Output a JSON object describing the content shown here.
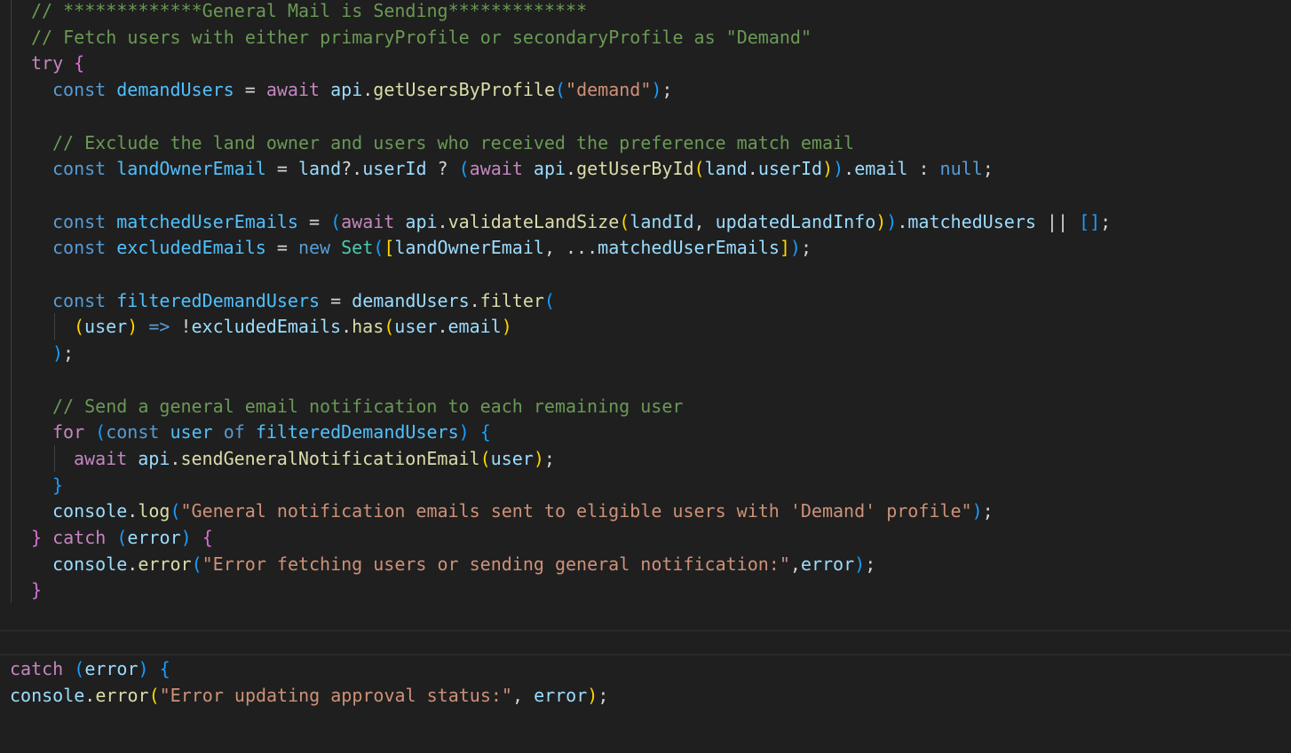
{
  "colors": {
    "background": "#1f1f1f",
    "comment": "#6A9955",
    "keyword": "#569CD6",
    "string": "#CE9178",
    "function": "#DCDCAA",
    "control": "#C586C0"
  },
  "code": [
    {
      "indent": 0,
      "tokens": [
        [
          "// *************General Mail is Sending*************",
          "c"
        ]
      ]
    },
    {
      "indent": 0,
      "tokens": [
        [
          "// Fetch users with either primaryProfile or secondaryProfile as \"Demand\"",
          "c"
        ]
      ]
    },
    {
      "indent": 0,
      "tokens": [
        [
          "try",
          "ctl"
        ],
        [
          " ",
          "o"
        ],
        [
          "{",
          "b2"
        ]
      ]
    },
    {
      "indent": 1,
      "tokens": [
        [
          "const",
          "k"
        ],
        [
          " ",
          "o"
        ],
        [
          "demandUsers",
          "v"
        ],
        [
          " = ",
          "o"
        ],
        [
          "await",
          "ctl"
        ],
        [
          " ",
          "o"
        ],
        [
          "api",
          "p"
        ],
        [
          ".",
          "o"
        ],
        [
          "getUsersByProfile",
          "f"
        ],
        [
          "(",
          "b3"
        ],
        [
          "\"demand\"",
          "s"
        ],
        [
          ")",
          "b3"
        ],
        [
          ";",
          "o"
        ]
      ]
    },
    {
      "indent": 1,
      "tokens": []
    },
    {
      "indent": 1,
      "tokens": [
        [
          "// Exclude the land owner and users who received the preference match email",
          "c"
        ]
      ]
    },
    {
      "indent": 1,
      "tokens": [
        [
          "const",
          "k"
        ],
        [
          " ",
          "o"
        ],
        [
          "landOwnerEmail",
          "v"
        ],
        [
          " = ",
          "o"
        ],
        [
          "land",
          "p"
        ],
        [
          "?.",
          "o"
        ],
        [
          "userId",
          "p"
        ],
        [
          " ? ",
          "o"
        ],
        [
          "(",
          "b3"
        ],
        [
          "await",
          "ctl"
        ],
        [
          " ",
          "o"
        ],
        [
          "api",
          "p"
        ],
        [
          ".",
          "o"
        ],
        [
          "getUserById",
          "f"
        ],
        [
          "(",
          "b1"
        ],
        [
          "land",
          "p"
        ],
        [
          ".",
          "o"
        ],
        [
          "userId",
          "p"
        ],
        [
          ")",
          "b1"
        ],
        [
          ")",
          "b3"
        ],
        [
          ".",
          "o"
        ],
        [
          "email",
          "p"
        ],
        [
          " : ",
          "o"
        ],
        [
          "null",
          "k"
        ],
        [
          ";",
          "o"
        ]
      ]
    },
    {
      "indent": 1,
      "tokens": []
    },
    {
      "indent": 1,
      "tokens": [
        [
          "const",
          "k"
        ],
        [
          " ",
          "o"
        ],
        [
          "matchedUserEmails",
          "v"
        ],
        [
          " = ",
          "o"
        ],
        [
          "(",
          "b3"
        ],
        [
          "await",
          "ctl"
        ],
        [
          " ",
          "o"
        ],
        [
          "api",
          "p"
        ],
        [
          ".",
          "o"
        ],
        [
          "validateLandSize",
          "f"
        ],
        [
          "(",
          "b1"
        ],
        [
          "landId",
          "p"
        ],
        [
          ", ",
          "o"
        ],
        [
          "updatedLandInfo",
          "p"
        ],
        [
          ")",
          "b1"
        ],
        [
          ")",
          "b3"
        ],
        [
          ".",
          "o"
        ],
        [
          "matchedUsers",
          "p"
        ],
        [
          " || ",
          "o"
        ],
        [
          "[]",
          "b3"
        ],
        [
          ";",
          "o"
        ]
      ]
    },
    {
      "indent": 1,
      "tokens": [
        [
          "const",
          "k"
        ],
        [
          " ",
          "o"
        ],
        [
          "excludedEmails",
          "v"
        ],
        [
          " = ",
          "o"
        ],
        [
          "new",
          "k"
        ],
        [
          " ",
          "o"
        ],
        [
          "Set",
          "t"
        ],
        [
          "(",
          "b3"
        ],
        [
          "[",
          "b1"
        ],
        [
          "landOwnerEmail",
          "p"
        ],
        [
          ", ...",
          "o"
        ],
        [
          "matchedUserEmails",
          "p"
        ],
        [
          "]",
          "b1"
        ],
        [
          ")",
          "b3"
        ],
        [
          ";",
          "o"
        ]
      ]
    },
    {
      "indent": 1,
      "tokens": []
    },
    {
      "indent": 1,
      "tokens": [
        [
          "const",
          "k"
        ],
        [
          " ",
          "o"
        ],
        [
          "filteredDemandUsers",
          "v"
        ],
        [
          " = ",
          "o"
        ],
        [
          "demandUsers",
          "p"
        ],
        [
          ".",
          "o"
        ],
        [
          "filter",
          "f"
        ],
        [
          "(",
          "b3"
        ]
      ]
    },
    {
      "indent": 2,
      "tokens": [
        [
          "(",
          "b1"
        ],
        [
          "user",
          "p"
        ],
        [
          ")",
          "b1"
        ],
        [
          " ",
          "o"
        ],
        [
          "=>",
          "k"
        ],
        [
          " !",
          "o"
        ],
        [
          "excludedEmails",
          "p"
        ],
        [
          ".",
          "o"
        ],
        [
          "has",
          "f"
        ],
        [
          "(",
          "b1"
        ],
        [
          "user",
          "p"
        ],
        [
          ".",
          "o"
        ],
        [
          "email",
          "p"
        ],
        [
          ")",
          "b1"
        ]
      ]
    },
    {
      "indent": 1,
      "tokens": [
        [
          ")",
          "b3"
        ],
        [
          ";",
          "o"
        ]
      ]
    },
    {
      "indent": 1,
      "tokens": []
    },
    {
      "indent": 1,
      "tokens": [
        [
          "// Send a general email notification to each remaining user",
          "c"
        ]
      ]
    },
    {
      "indent": 1,
      "tokens": [
        [
          "for",
          "ctl"
        ],
        [
          " ",
          "o"
        ],
        [
          "(",
          "b3"
        ],
        [
          "const",
          "k"
        ],
        [
          " ",
          "o"
        ],
        [
          "user",
          "v"
        ],
        [
          " ",
          "o"
        ],
        [
          "of",
          "k"
        ],
        [
          " ",
          "o"
        ],
        [
          "filteredDemandUsers",
          "v"
        ],
        [
          ")",
          "b3"
        ],
        [
          " ",
          "o"
        ],
        [
          "{",
          "b3"
        ]
      ]
    },
    {
      "indent": 2,
      "tokens": [
        [
          "await",
          "ctl"
        ],
        [
          " ",
          "o"
        ],
        [
          "api",
          "p"
        ],
        [
          ".",
          "o"
        ],
        [
          "sendGeneralNotificationEmail",
          "f"
        ],
        [
          "(",
          "b1"
        ],
        [
          "user",
          "p"
        ],
        [
          ")",
          "b1"
        ],
        [
          ";",
          "o"
        ]
      ]
    },
    {
      "indent": 1,
      "tokens": [
        [
          "}",
          "b3"
        ]
      ]
    },
    {
      "indent": 1,
      "tokens": [
        [
          "console",
          "p"
        ],
        [
          ".",
          "o"
        ],
        [
          "log",
          "f"
        ],
        [
          "(",
          "b3"
        ],
        [
          "\"General notification emails sent to eligible users with 'Demand' profile\"",
          "s"
        ],
        [
          ")",
          "b3"
        ],
        [
          ";",
          "o"
        ]
      ]
    },
    {
      "indent": 0,
      "tokens": [
        [
          "}",
          "b2"
        ],
        [
          " ",
          "o"
        ],
        [
          "catch",
          "ctl"
        ],
        [
          " ",
          "o"
        ],
        [
          "(",
          "b3"
        ],
        [
          "error",
          "p"
        ],
        [
          ")",
          "b3"
        ],
        [
          " ",
          "o"
        ],
        [
          "{",
          "b2"
        ]
      ]
    },
    {
      "indent": 1,
      "tokens": [
        [
          "console",
          "p"
        ],
        [
          ".",
          "o"
        ],
        [
          "error",
          "f"
        ],
        [
          "(",
          "b3"
        ],
        [
          "\"Error fetching users or sending general notification:\"",
          "s"
        ],
        [
          ",",
          "o"
        ],
        [
          "error",
          "p"
        ],
        [
          ")",
          "b3"
        ],
        [
          ";",
          "o"
        ]
      ]
    },
    {
      "indent": 0,
      "tokens": [
        [
          "}",
          "b2"
        ]
      ]
    }
  ],
  "bottom_code": [
    {
      "indent": 0,
      "tokens": [
        [
          "catch",
          "ctl"
        ],
        [
          " ",
          "o"
        ],
        [
          "(",
          "b3"
        ],
        [
          "error",
          "p"
        ],
        [
          ")",
          "b3"
        ],
        [
          " ",
          "o"
        ],
        [
          "{",
          "b3"
        ]
      ]
    },
    {
      "indent": 0,
      "tokens": [
        [
          "console",
          "p"
        ],
        [
          ".",
          "o"
        ],
        [
          "error",
          "f"
        ],
        [
          "(",
          "b1"
        ],
        [
          "\"Error updating approval status:\"",
          "s"
        ],
        [
          ", ",
          "o"
        ],
        [
          "error",
          "p"
        ],
        [
          ")",
          "b1"
        ],
        [
          ";",
          "o"
        ]
      ]
    }
  ]
}
